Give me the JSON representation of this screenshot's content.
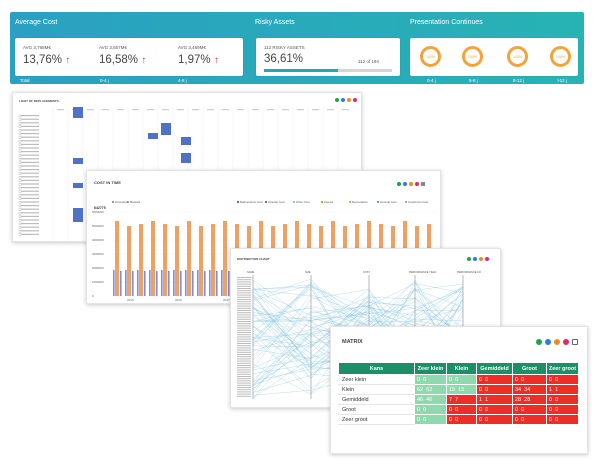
{
  "banner": {
    "sections": [
      "Average Cost",
      "Risky Assets",
      "Presentation Continues"
    ],
    "kpis": [
      {
        "label": "AVG 3,768M€",
        "value": "13,76%",
        "footer": "Total"
      },
      {
        "label": "AVG 3,557M€",
        "value": "16,58%",
        "footer": "0-4 j"
      },
      {
        "label": "AVG 3,469M€",
        "value": "1,97%",
        "footer": "4-8 j"
      }
    ],
    "risky": {
      "label": "112 RISKY ASSETS",
      "value": "36,61%",
      "count": "112 of 194",
      "progress": 0.58
    },
    "rings": [
      {
        "value": "100%",
        "footer": "0-4 j"
      },
      {
        "value": "100%",
        "footer": "5-8 j"
      },
      {
        "value": "100%",
        "footer": "8-12 j"
      },
      {
        "value": "100%",
        "footer": ">12 j"
      }
    ]
  },
  "colors": {
    "accent": "#2aa0c2",
    "arrow": "#e23030",
    "ring": "#f2a33a",
    "header": "#1a8f68",
    "good": "#8ed9ad",
    "bad": "#ee2d26"
  },
  "gantt": {
    "title": "LIGHT OF DEPLACEMENTS"
  },
  "cost": {
    "title": "COST IN TIME",
    "value": "642775",
    "legend_left": [
      "Occupied",
      "Booked"
    ],
    "legend_right": [
      "Maintenance Cost",
      "Operate Cost",
      "Other Cost",
      "Interest",
      "Depreciation",
      "General Cost",
      "Investment Cost"
    ]
  },
  "distribution": {
    "title": "DISTRIBUTION CHART",
    "axes": [
      "NAME",
      "SIZE",
      "COST",
      "PERFORMANCE YIELD",
      "PERFORMANCE CR"
    ]
  },
  "matrix": {
    "title": "MATRIX",
    "headers": [
      "Kans",
      "Zeer klein",
      "Klein",
      "Gemiddeld",
      "Groot",
      "Zeer groot"
    ],
    "rows": [
      {
        "label": "Zeer klein",
        "cells": [
          [
            "0",
            "0"
          ],
          [
            "0",
            "0"
          ],
          [
            "0",
            "0"
          ],
          [
            "0",
            "0"
          ],
          [
            "0",
            "0"
          ]
        ]
      },
      {
        "label": "Klein",
        "cells": [
          [
            "62",
            "62"
          ],
          [
            "15",
            "15"
          ],
          [
            "0",
            "0"
          ],
          [
            "34",
            "34"
          ],
          [
            "1",
            "1"
          ]
        ]
      },
      {
        "label": "Gemiddeld",
        "cells": [
          [
            "46",
            "46"
          ],
          [
            "7",
            "7"
          ],
          [
            "1",
            "1"
          ],
          [
            "28",
            "28"
          ],
          [
            "0",
            "0"
          ]
        ]
      },
      {
        "label": "Groot",
        "cells": [
          [
            "0",
            "0"
          ],
          [
            "0",
            "0"
          ],
          [
            "0",
            "0"
          ],
          [
            "0",
            "0"
          ],
          [
            "0",
            "0"
          ]
        ]
      },
      {
        "label": "Zeer groot",
        "cells": [
          [
            "0",
            "0"
          ],
          [
            "0",
            "0"
          ],
          [
            "0",
            "0"
          ],
          [
            "0",
            "0"
          ],
          [
            "0",
            "0"
          ]
        ]
      }
    ]
  }
}
